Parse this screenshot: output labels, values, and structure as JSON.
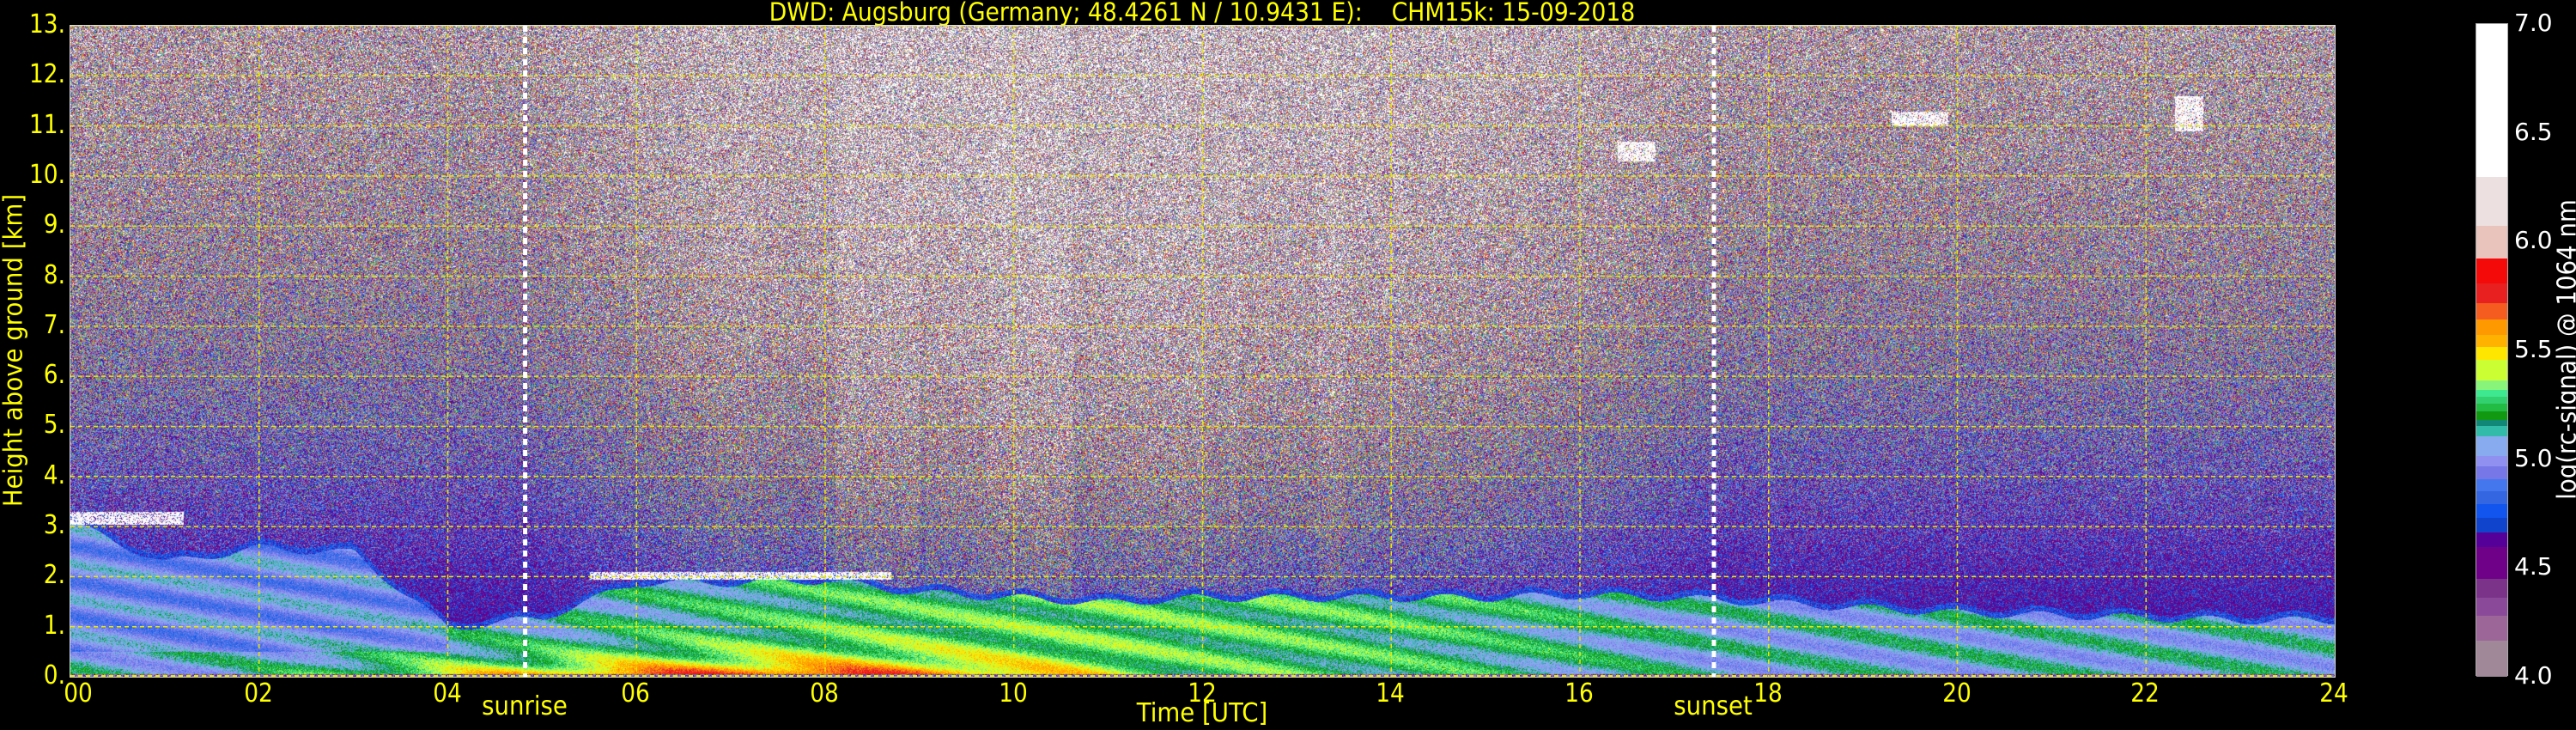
{
  "chart_data": {
    "type": "heatmap",
    "title": "DWD: Augsburg (Germany; 48.4261 N / 10.9431 E):    CHM15k: 15-09-2018",
    "xlabel": "Time [UTC]",
    "ylabel": "Height above ground [km]",
    "xlim": [
      0,
      24
    ],
    "ylim": [
      0,
      13
    ],
    "x_ticks": [
      "00",
      "02",
      "04",
      "06",
      "08",
      "10",
      "12",
      "14",
      "16",
      "18",
      "20",
      "22",
      "24"
    ],
    "y_ticks": [
      "0.",
      "1.",
      "2.",
      "3.",
      "4.",
      "5.",
      "6.",
      "7.",
      "8.",
      "9.",
      "10.",
      "11.",
      "12.",
      "13."
    ],
    "grid": true,
    "annotations": [
      {
        "label": "sunrise",
        "time_utc": 4.82
      },
      {
        "label": "sunset",
        "time_utc": 17.42
      }
    ],
    "colorbar": {
      "label": "log(rc-signal) @ 1064 nm",
      "range": [
        4.0,
        7.0
      ],
      "ticks": [
        "7.0",
        "6.5",
        "6.0",
        "5.5",
        "5.0",
        "4.5",
        "4.0"
      ],
      "bands": [
        {
          "from": 6.297,
          "to": 7.0,
          "color": "#ffffff"
        },
        {
          "from": 6.074,
          "to": 6.297,
          "color": "#ede0e0"
        },
        {
          "from": 5.924,
          "to": 6.074,
          "color": "#e8c4bd"
        },
        {
          "from": 5.806,
          "to": 5.924,
          "color": "#f50a0a"
        },
        {
          "from": 5.719,
          "to": 5.806,
          "color": "#e82020"
        },
        {
          "from": 5.641,
          "to": 5.719,
          "color": "#f45c20"
        },
        {
          "from": 5.573,
          "to": 5.641,
          "color": "#ff9900"
        },
        {
          "from": 5.515,
          "to": 5.573,
          "color": "#ffb300"
        },
        {
          "from": 5.457,
          "to": 5.515,
          "color": "#ffe600"
        },
        {
          "from": 5.361,
          "to": 5.457,
          "color": "#ccff33"
        },
        {
          "from": 5.318,
          "to": 5.361,
          "color": "#88f57a"
        },
        {
          "from": 5.286,
          "to": 5.318,
          "color": "#3de890"
        },
        {
          "from": 5.256,
          "to": 5.286,
          "color": "#33d070"
        },
        {
          "from": 5.221,
          "to": 5.256,
          "color": "#22bb44"
        },
        {
          "from": 5.179,
          "to": 5.221,
          "color": "#119911"
        },
        {
          "from": 5.153,
          "to": 5.179,
          "color": "#118877"
        },
        {
          "from": 5.104,
          "to": 5.153,
          "color": "#33bbaa"
        },
        {
          "from": 5.014,
          "to": 5.104,
          "color": "#88aaee"
        },
        {
          "from": 4.969,
          "to": 5.014,
          "color": "#8f90f0"
        },
        {
          "from": 4.909,
          "to": 4.969,
          "color": "#7777e8"
        },
        {
          "from": 4.851,
          "to": 4.909,
          "color": "#4477ee"
        },
        {
          "from": 4.794,
          "to": 4.851,
          "color": "#3366e0"
        },
        {
          "from": 4.729,
          "to": 4.794,
          "color": "#1155ee"
        },
        {
          "from": 4.665,
          "to": 4.729,
          "color": "#1144cc"
        },
        {
          "from": 4.596,
          "to": 4.665,
          "color": "#550099"
        },
        {
          "from": 4.45,
          "to": 4.596,
          "color": "#6f0088"
        },
        {
          "from": 4.364,
          "to": 4.45,
          "color": "#7a3388"
        },
        {
          "from": 4.279,
          "to": 4.364,
          "color": "#8b4a99"
        },
        {
          "from": 4.167,
          "to": 4.279,
          "color": "#9c6699"
        },
        {
          "from": 4.0,
          "to": 4.167,
          "color": "#a08898"
        }
      ]
    },
    "boundary_layer_top_km": {
      "hours": [
        0,
        1,
        2,
        3,
        4,
        5,
        6,
        7,
        8,
        9,
        10,
        11,
        12,
        13,
        14,
        15,
        16,
        17,
        18,
        19,
        20,
        21,
        22,
        23,
        24
      ],
      "values": [
        3.2,
        2.4,
        2.7,
        2.6,
        1.1,
        1.3,
        2.0,
        2.0,
        2.05,
        1.8,
        1.7,
        1.6,
        1.7,
        1.7,
        1.7,
        1.7,
        1.75,
        1.7,
        1.6,
        1.5,
        1.4,
        1.35,
        1.3,
        1.25,
        1.25
      ]
    },
    "cloud_layers": [
      {
        "start_utc": 0.0,
        "end_utc": 1.2,
        "base_km": 3.05,
        "top_km": 3.3
      },
      {
        "start_utc": 5.5,
        "end_utc": 8.7,
        "base_km": 1.95,
        "top_km": 2.1
      },
      {
        "start_utc": 16.4,
        "end_utc": 16.8,
        "base_km": 10.3,
        "top_km": 10.7
      },
      {
        "start_utc": 19.3,
        "end_utc": 19.9,
        "base_km": 11.0,
        "top_km": 11.3
      },
      {
        "start_utc": 22.3,
        "end_utc": 22.6,
        "base_km": 10.9,
        "top_km": 11.6
      }
    ]
  }
}
